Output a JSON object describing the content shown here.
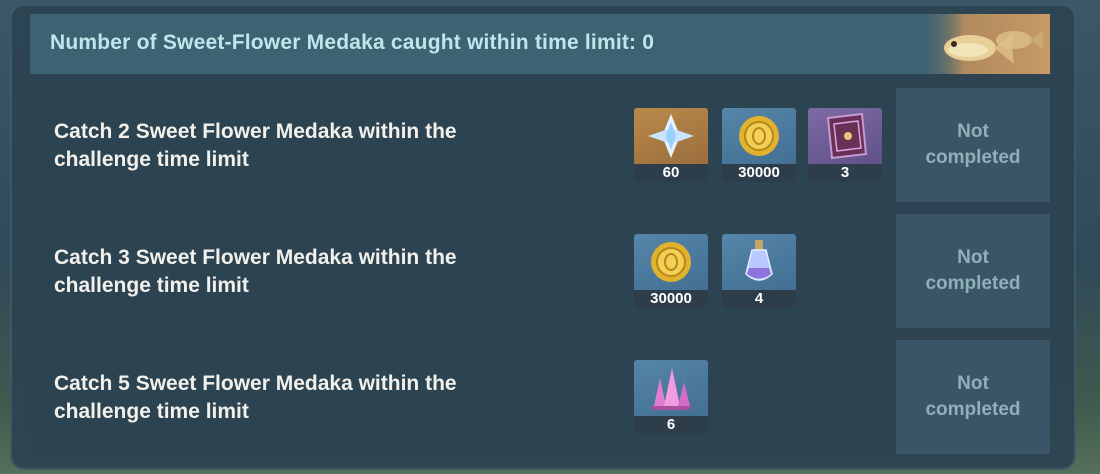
{
  "header": {
    "text": "Number of Sweet-Flower Medaka caught within time limit: 0",
    "icon": "fish-icon"
  },
  "challenges": [
    {
      "line1": "Catch 2 Sweet Flower Medaka within the",
      "line2": "challenge time limit",
      "rewards": [
        {
          "icon": "primogem-icon",
          "count": "60"
        },
        {
          "icon": "mora-icon",
          "count": "30000"
        },
        {
          "icon": "book-icon",
          "count": "3"
        }
      ],
      "status": "Not completed"
    },
    {
      "line1": "Catch 3 Sweet Flower Medaka within the",
      "line2": "challenge time limit",
      "rewards": [
        {
          "icon": "mora-icon",
          "count": "30000"
        },
        {
          "icon": "potion-icon",
          "count": "4"
        }
      ],
      "status": "Not completed"
    },
    {
      "line1": "Catch 5 Sweet Flower Medaka within the",
      "line2": "challenge time limit",
      "rewards": [
        {
          "icon": "crystal-icon",
          "count": "6"
        }
      ],
      "status": "Not completed"
    }
  ]
}
